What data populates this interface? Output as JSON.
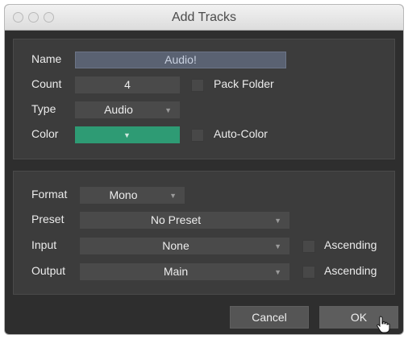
{
  "window": {
    "title": "Add Tracks"
  },
  "track": {
    "name_label": "Name",
    "name_value": "Audio!",
    "count_label": "Count",
    "count_value": "4",
    "pack_folder_label": "Pack Folder",
    "type_label": "Type",
    "type_value": "Audio",
    "color_label": "Color",
    "color_value": "#2e9b74",
    "auto_color_label": "Auto-Color"
  },
  "io": {
    "format_label": "Format",
    "format_value": "Mono",
    "preset_label": "Preset",
    "preset_value": "No Preset",
    "input_label": "Input",
    "input_value": "None",
    "input_ascending_label": "Ascending",
    "output_label": "Output",
    "output_value": "Main",
    "output_ascending_label": "Ascending"
  },
  "buttons": {
    "cancel_label": "Cancel",
    "ok_label": "OK"
  },
  "icons": {
    "dropdown": "chevron-down-icon",
    "cursor": "hand-pointer-icon"
  }
}
